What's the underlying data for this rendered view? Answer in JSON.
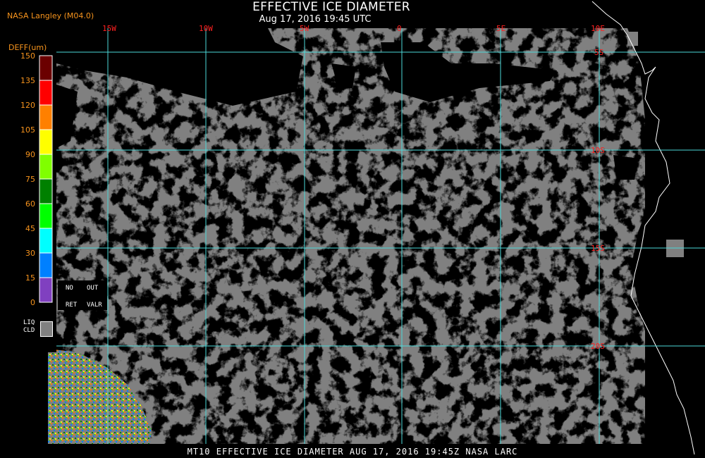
{
  "producer": "NASA Langley (M04.0)",
  "title": "EFFECTIVE ICE DIAMETER",
  "subtitle": "Aug 17, 2016 19:45 UTC",
  "footer": "MT10  EFFECTIVE ICE DIAMETER   AUG 17, 2016 19:45Z   NASA LARC",
  "legend": {
    "title": "DEFF(um)",
    "values": [
      "150",
      "135",
      "120",
      "105",
      "90",
      "75",
      "60",
      "45",
      "30",
      "15",
      "0"
    ],
    "colors": [
      "#6b0000",
      "#ff0000",
      "#ff8000",
      "#ffff00",
      "#80ff00",
      "#008000",
      "#00ff00",
      "#00ffff",
      "#0080ff",
      "#0000ff",
      "#8040c0"
    ],
    "no_retrieval": [
      "NO",
      "RET"
    ],
    "out_of_range": [
      "OUT",
      "VALR"
    ],
    "liquid_cloud": [
      "LIQ",
      "CLD"
    ],
    "liquid_cloud_color": "#808080"
  },
  "grid": {
    "longitude_labels": [
      "15W",
      "10W",
      "5W",
      "0",
      "5E",
      "10E"
    ],
    "latitude_labels": [
      "5S",
      "10S",
      "15S",
      "20S"
    ],
    "line_color": "#4dd9d9",
    "label_color": "#ff2020"
  },
  "colors": {
    "background": "#000000",
    "cloud_liquid": "#808080",
    "coastline": "#ffffff"
  }
}
